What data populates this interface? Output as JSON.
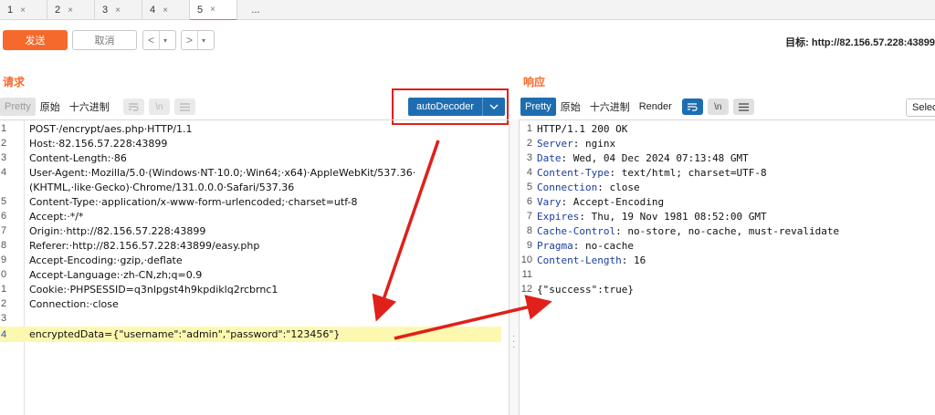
{
  "tabs": [
    {
      "label": "1",
      "close": "×"
    },
    {
      "label": "2",
      "close": "×"
    },
    {
      "label": "3",
      "close": "×"
    },
    {
      "label": "4",
      "close": "×"
    },
    {
      "label": "5",
      "close": "×",
      "active": true
    },
    {
      "label": "..."
    }
  ],
  "toolbar": {
    "send_label": "发送",
    "cancel_label": "取消",
    "back_glyph": "<",
    "forward_glyph": ">",
    "dropdown_glyph": "▾",
    "target_text": "目标: http://82.156.57.228:43899"
  },
  "request": {
    "title": "请求",
    "view_tabs": [
      "Pretty",
      "原始",
      "十六进制"
    ],
    "autodecoder_label": "autoDecoder",
    "autodecoder_chevron": "⌄",
    "icons": [
      "wrap-icon",
      "newline-icon",
      "menu-icon"
    ],
    "lines": [
      {
        "num": "1",
        "text": "POST·/encrypt/aes.php·HTTP/1.1"
      },
      {
        "num": "2",
        "text": "Host:·82.156.57.228:43899"
      },
      {
        "num": "3",
        "text": "Content-Length:·86"
      },
      {
        "num": "4",
        "text": "User-Agent:·Mozilla/5.0·(Windows·NT·10.0;·Win64;·x64)·AppleWebKit/537.36·"
      },
      {
        "num": "",
        "text": "(KHTML,·like·Gecko)·Chrome/131.0.0.0·Safari/537.36"
      },
      {
        "num": "5",
        "text": "Content-Type:·application/x-www-form-urlencoded;·charset=utf-8"
      },
      {
        "num": "6",
        "text": "Accept:·*/*"
      },
      {
        "num": "7",
        "text": "Origin:·http://82.156.57.228:43899"
      },
      {
        "num": "8",
        "text": "Referer:·http://82.156.57.228:43899/easy.php"
      },
      {
        "num": "9",
        "text": "Accept-Encoding:·gzip,·deflate"
      },
      {
        "num": "0",
        "text": "Accept-Language:·zh-CN,zh;q=0.9"
      },
      {
        "num": "1",
        "text": "Cookie:·PHPSESSID=q3nlpgst4h9kpdiklq2rcbrnc1"
      },
      {
        "num": "2",
        "text": "Connection:·close"
      },
      {
        "num": "3",
        "text": ""
      },
      {
        "num": "4",
        "text": "encryptedData={\"username\":\"admin\",\"password\":\"123456\"}",
        "highlight": true
      }
    ]
  },
  "response": {
    "title": "响应",
    "view_tabs": [
      "Pretty",
      "原始",
      "十六进制",
      "Render"
    ],
    "select_label": "Select",
    "lines": [
      {
        "num": "1",
        "key": "",
        "text": "HTTP/1.1 200 OK"
      },
      {
        "num": "2",
        "key": "Server",
        "text": ": nginx"
      },
      {
        "num": "3",
        "key": "Date",
        "text": ": Wed, 04 Dec 2024 07:13:48 GMT"
      },
      {
        "num": "4",
        "key": "Content-Type",
        "text": ": text/html; charset=UTF-8"
      },
      {
        "num": "5",
        "key": "Connection",
        "text": ": close"
      },
      {
        "num": "6",
        "key": "Vary",
        "text": ": Accept-Encoding"
      },
      {
        "num": "7",
        "key": "Expires",
        "text": ": Thu, 19 Nov 1981 08:52:00 GMT"
      },
      {
        "num": "8",
        "key": "Cache-Control",
        "text": ": no-store, no-cache, must-revalidate"
      },
      {
        "num": "9",
        "key": "Pragma",
        "text": ": no-cache"
      },
      {
        "num": "10",
        "key": "Content-Length",
        "text": ": 16"
      },
      {
        "num": "11",
        "key": "",
        "text": ""
      },
      {
        "num": "12",
        "key": "",
        "text": "{\"success\":true}"
      }
    ]
  },
  "colors": {
    "accent": "#f56a2c",
    "blue": "#1f6db1",
    "annotation_red": "#e0201a",
    "highlight": "#fdf8b0"
  }
}
